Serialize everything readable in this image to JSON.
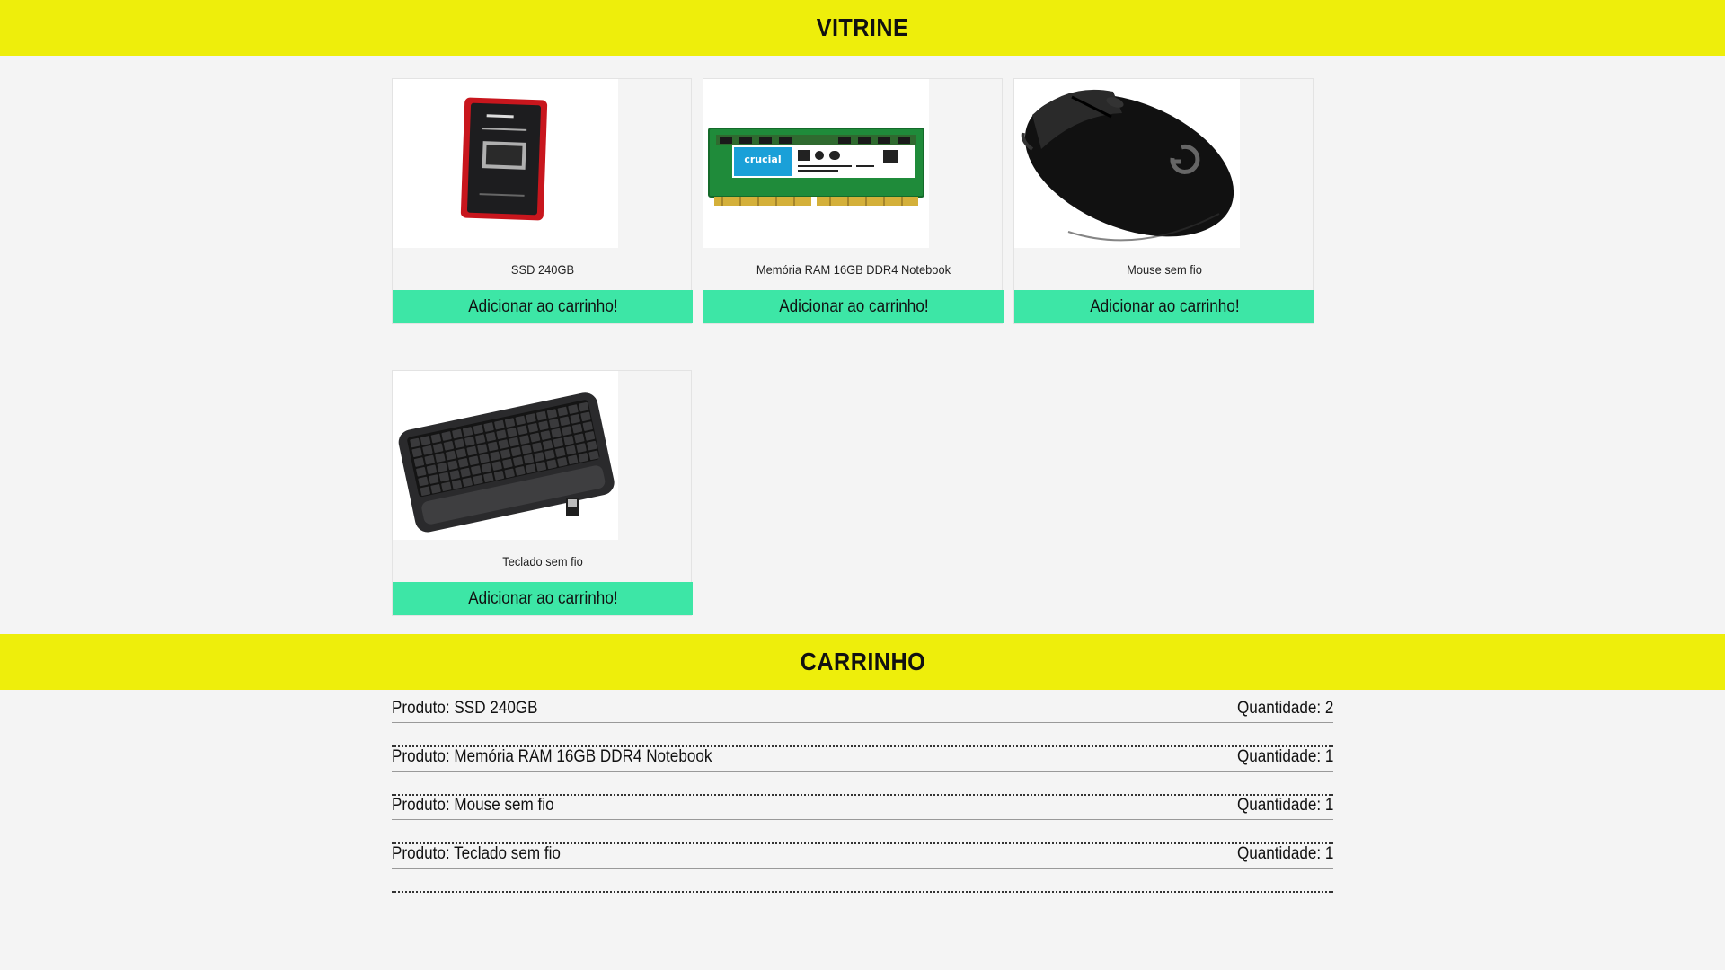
{
  "vitrine": {
    "title": "VITRINE",
    "products": [
      {
        "name": "SSD 240GB",
        "button": "Adicionar ao carrinho!",
        "image_icon": "ssd-image"
      },
      {
        "name": "Memória RAM 16GB DDR4 Notebook",
        "button": "Adicionar ao carrinho!",
        "image_icon": "ram-image"
      },
      {
        "name": "Mouse sem fio",
        "button": "Adicionar ao carrinho!",
        "image_icon": "mouse-image"
      },
      {
        "name": "Teclado sem fio",
        "button": "Adicionar ao carrinho!",
        "image_icon": "keyboard-image"
      }
    ]
  },
  "carrinho": {
    "title": "CARRINHO",
    "items": [
      {
        "produto": "Produto: SSD 240GB",
        "quantidade": "Quantidade: 2"
      },
      {
        "produto": "Produto: Memória RAM 16GB DDR4 Notebook",
        "quantidade": "Quantidade: 1"
      },
      {
        "produto": "Produto: Mouse sem fio",
        "quantidade": "Quantidade: 1"
      },
      {
        "produto": "Produto: Teclado sem fio",
        "quantidade": "Quantidade: 1"
      }
    ]
  },
  "colors": {
    "banner": "#eeee0b",
    "button": "#3de6a6",
    "background": "#f4f4f4"
  }
}
